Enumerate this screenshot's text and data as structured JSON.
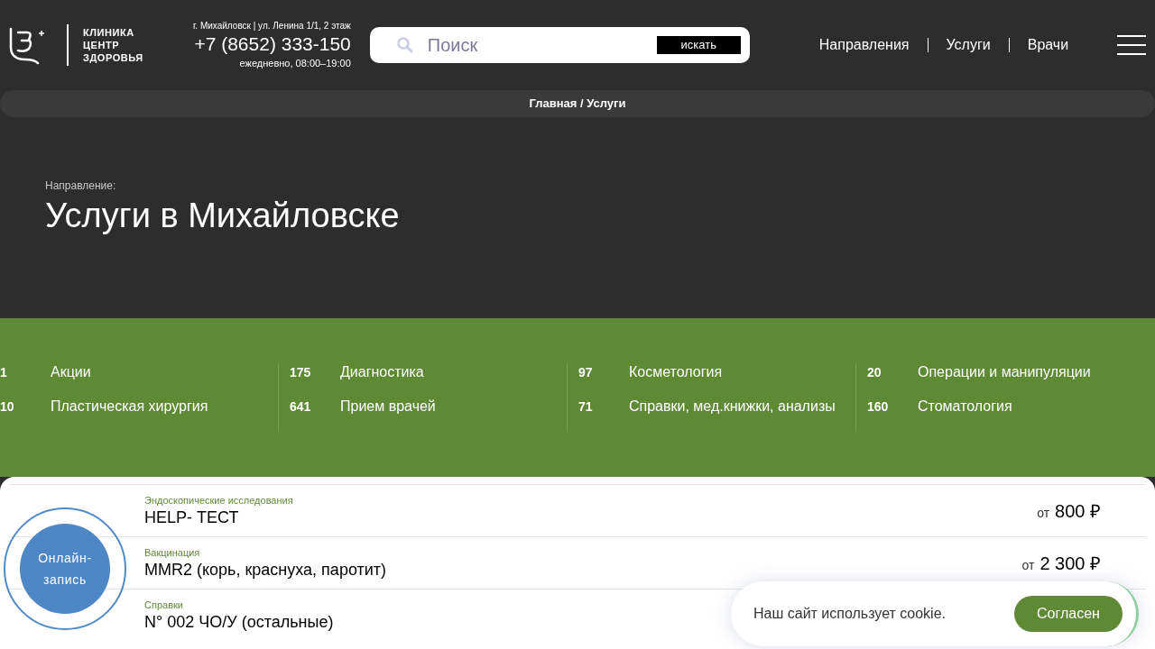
{
  "logo": {
    "lines": [
      "КЛИНИКА",
      "ЦЕНТР",
      "ЗДОРОВЬЯ"
    ]
  },
  "contact": {
    "address": "г. Михайловск | ул. Ленина 1/1, 2 этаж",
    "phone": "+7 (8652) 333-150",
    "hours": "ежедневно, 08:00–19:00"
  },
  "search": {
    "placeholder": "Поиск",
    "button": "искать"
  },
  "nav": [
    "Направления",
    "Услуги",
    "Врачи"
  ],
  "breadcrumb": "Главная / Услуги",
  "hero": {
    "eyebrow": "Направление:",
    "title": "Услуги в Михайловске"
  },
  "categories": [
    [
      {
        "count": "1",
        "label": "Акции"
      },
      {
        "count": "10",
        "label": "Пластическая хирургия"
      }
    ],
    [
      {
        "count": "175",
        "label": "Диагностика"
      },
      {
        "count": "641",
        "label": "Прием врачей"
      }
    ],
    [
      {
        "count": "97",
        "label": "Косметология"
      },
      {
        "count": "71",
        "label": "Справки, мед.книжки, анализы"
      }
    ],
    [
      {
        "count": "20",
        "label": "Операции и манипуляции"
      },
      {
        "count": "160",
        "label": "Стоматология"
      }
    ]
  ],
  "services": [
    {
      "category": "Эндоскопические исследования",
      "name": "HELP- ТЕСТ",
      "prefix": "от",
      "price": "800 ₽"
    },
    {
      "category": "Вакцинация",
      "name": "MMR2 (корь, краснуха, паротит)",
      "prefix": "от",
      "price": "2 300 ₽"
    },
    {
      "category": "Справки",
      "name": "N° 002 ЧО/У (остальные)"
    }
  ],
  "booking": {
    "label": "Онлайн-запись"
  },
  "cookie": {
    "text": "Наш сайт использует cookie.",
    "button": "Согласен"
  }
}
